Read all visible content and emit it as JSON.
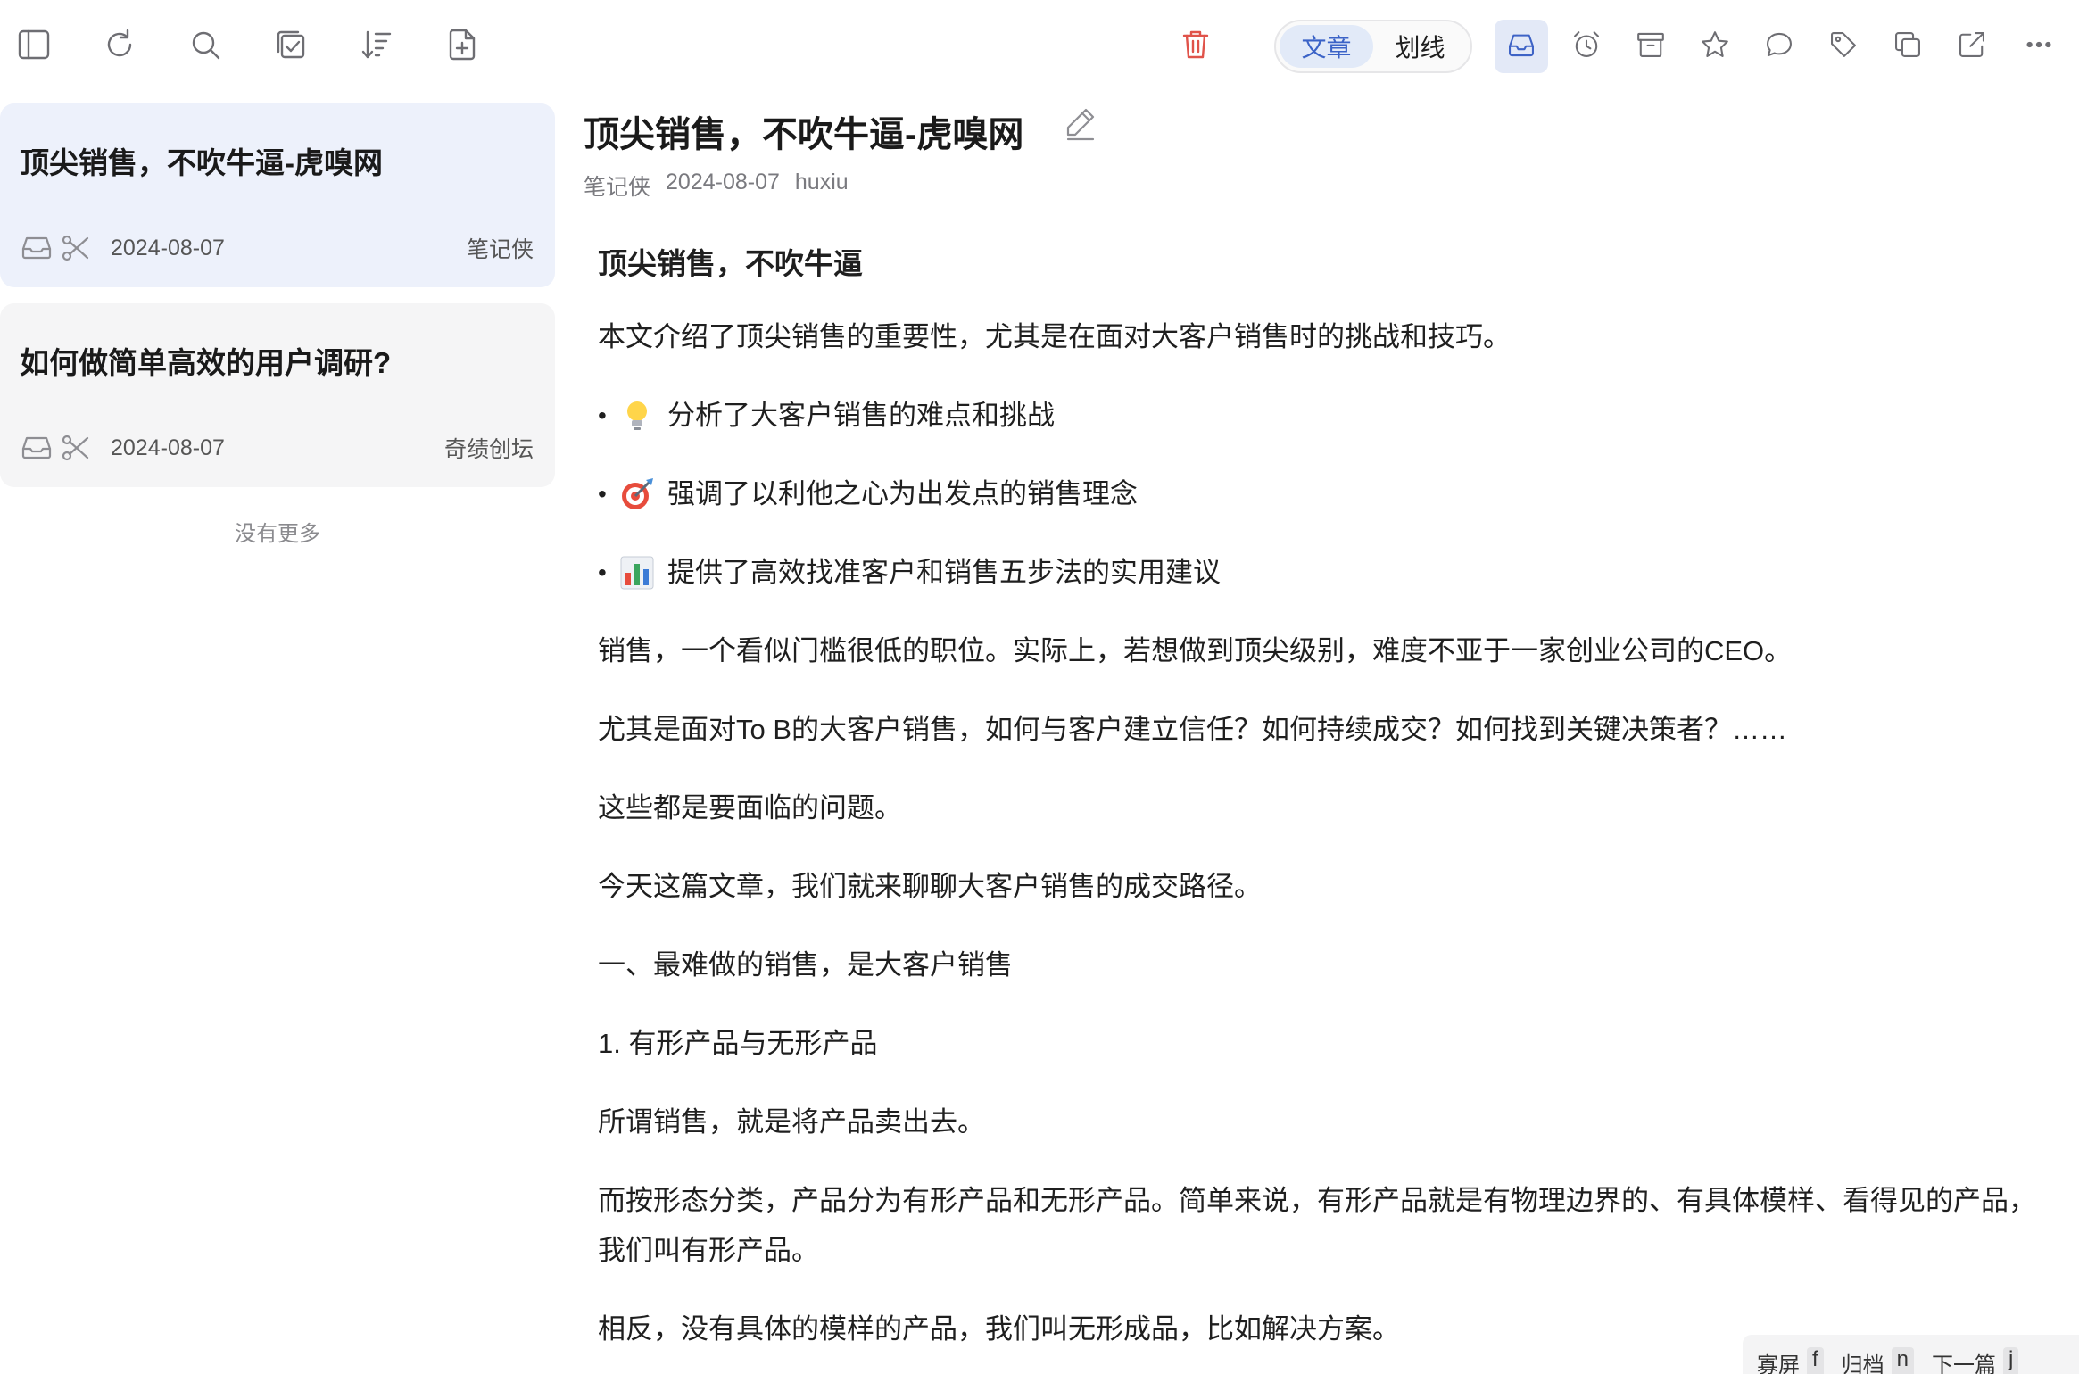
{
  "toolbar": {
    "left_icons": [
      "sidebar-toggle-icon",
      "refresh-icon",
      "search-icon",
      "multi-select-icon",
      "sort-icon",
      "new-document-icon"
    ],
    "tabs": [
      {
        "label": "文章",
        "active": true
      },
      {
        "label": "划线",
        "active": false
      }
    ],
    "right_icons": [
      "inbox-icon",
      "alarm-icon",
      "archive-icon",
      "star-icon",
      "comment-icon",
      "tag-icon",
      "copy-icon",
      "external-link-icon",
      "more-icon"
    ],
    "accent_color": "#3e63c6",
    "delete_color": "#e0534a"
  },
  "sidebar": {
    "items": [
      {
        "title": "顶尖销售，不吹牛逼-虎嗅网",
        "date": "2024-08-07",
        "source": "笔记侠",
        "selected": true
      },
      {
        "title": "如何做简单高效的用户调研?",
        "date": "2024-08-07",
        "source": "奇绩创坛",
        "selected": false
      }
    ],
    "no_more": "没有更多"
  },
  "article": {
    "title": "顶尖销售，不吹牛逼-虎嗅网",
    "meta": {
      "author": "笔记侠",
      "date": "2024-08-07",
      "site": "huxiu"
    },
    "heading": "顶尖销售，不吹牛逼",
    "intro": "本文介绍了顶尖销售的重要性，尤其是在面对大客户销售时的挑战和技巧。",
    "bullets": [
      {
        "icon": "lightbulb-icon",
        "text": "分析了大客户销售的难点和挑战"
      },
      {
        "icon": "target-icon",
        "text": "强调了以利他之心为出发点的销售理念"
      },
      {
        "icon": "bar-chart-icon",
        "text": "提供了高效找准客户和销售五步法的实用建议"
      }
    ],
    "paragraphs": [
      "销售，一个看似门槛很低的职位。实际上，若想做到顶尖级别，难度不亚于一家创业公司的CEO。",
      "尤其是面对To B的大客户销售，如何与客户建立信任？如何持续成交？如何找到关键决策者？……",
      "这些都是要面临的问题。",
      "今天这篇文章，我们就来聊聊大客户销售的成交路径。",
      "一、最难做的销售，是大客户销售",
      "1. 有形产品与无形产品",
      "所谓销售，就是将产品卖出去。",
      "而按形态分类，产品分为有形产品和无形产品。简单来说，有形产品就是有物理边界的、有具体模样、看得见的产品，我们叫有形产品。",
      "相反，没有具体的模样的产品，我们叫无形成品，比如解决方案。"
    ]
  },
  "hint_bar": {
    "items": [
      {
        "label": "寡屏",
        "key": "f"
      },
      {
        "label": "归档",
        "key": "n"
      },
      {
        "label": "下一篇",
        "key": "j"
      }
    ]
  }
}
